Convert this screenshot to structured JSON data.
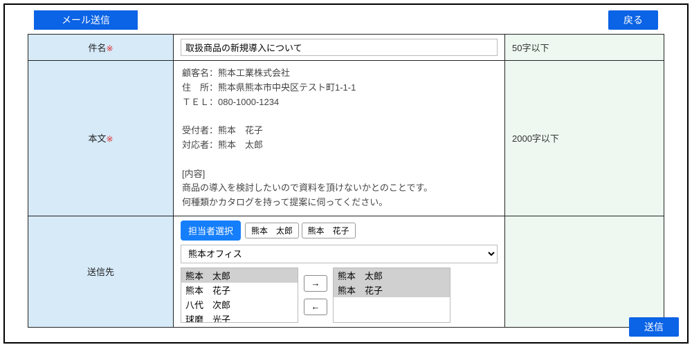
{
  "header": {
    "title": "メール送信",
    "back_label": "戻る"
  },
  "rows": {
    "subject": {
      "label": "件名",
      "required_mark": "※",
      "value": "取扱商品の新規導入について",
      "hint": "50字以下"
    },
    "body": {
      "label": "本文",
      "required_mark": "※",
      "hint": "2000字以下",
      "text": "顧客名：熊本工業株式会社\n住　所：熊本県熊本市中央区テスト町1-1-1\nＴＥＬ：080-1000-1234\n\n受付者：熊本　花子\n対応者：熊本　太郎\n\n[内容]\n商品の導入を検討したいので資料を頂けないかとのことです。\n何種類かカタログを持って提案に伺ってください。"
    },
    "dest": {
      "label": "送信先",
      "picker_button": "担当者選択",
      "chips": [
        "熊本　太郎",
        "熊本　花子"
      ],
      "office_selected": "熊本オフィス",
      "left_list": [
        {
          "name": "熊本　太郎",
          "selected": true
        },
        {
          "name": "熊本　花子",
          "selected": false
        },
        {
          "name": "八代　次郎",
          "selected": false
        },
        {
          "name": "球磨　光子",
          "selected": false
        }
      ],
      "arrow_right": "→",
      "arrow_left": "←",
      "right_list": [
        {
          "name": "熊本　太郎",
          "selected": true
        },
        {
          "name": "熊本　花子",
          "selected": true
        }
      ]
    }
  },
  "footer": {
    "send_label": "送信"
  }
}
